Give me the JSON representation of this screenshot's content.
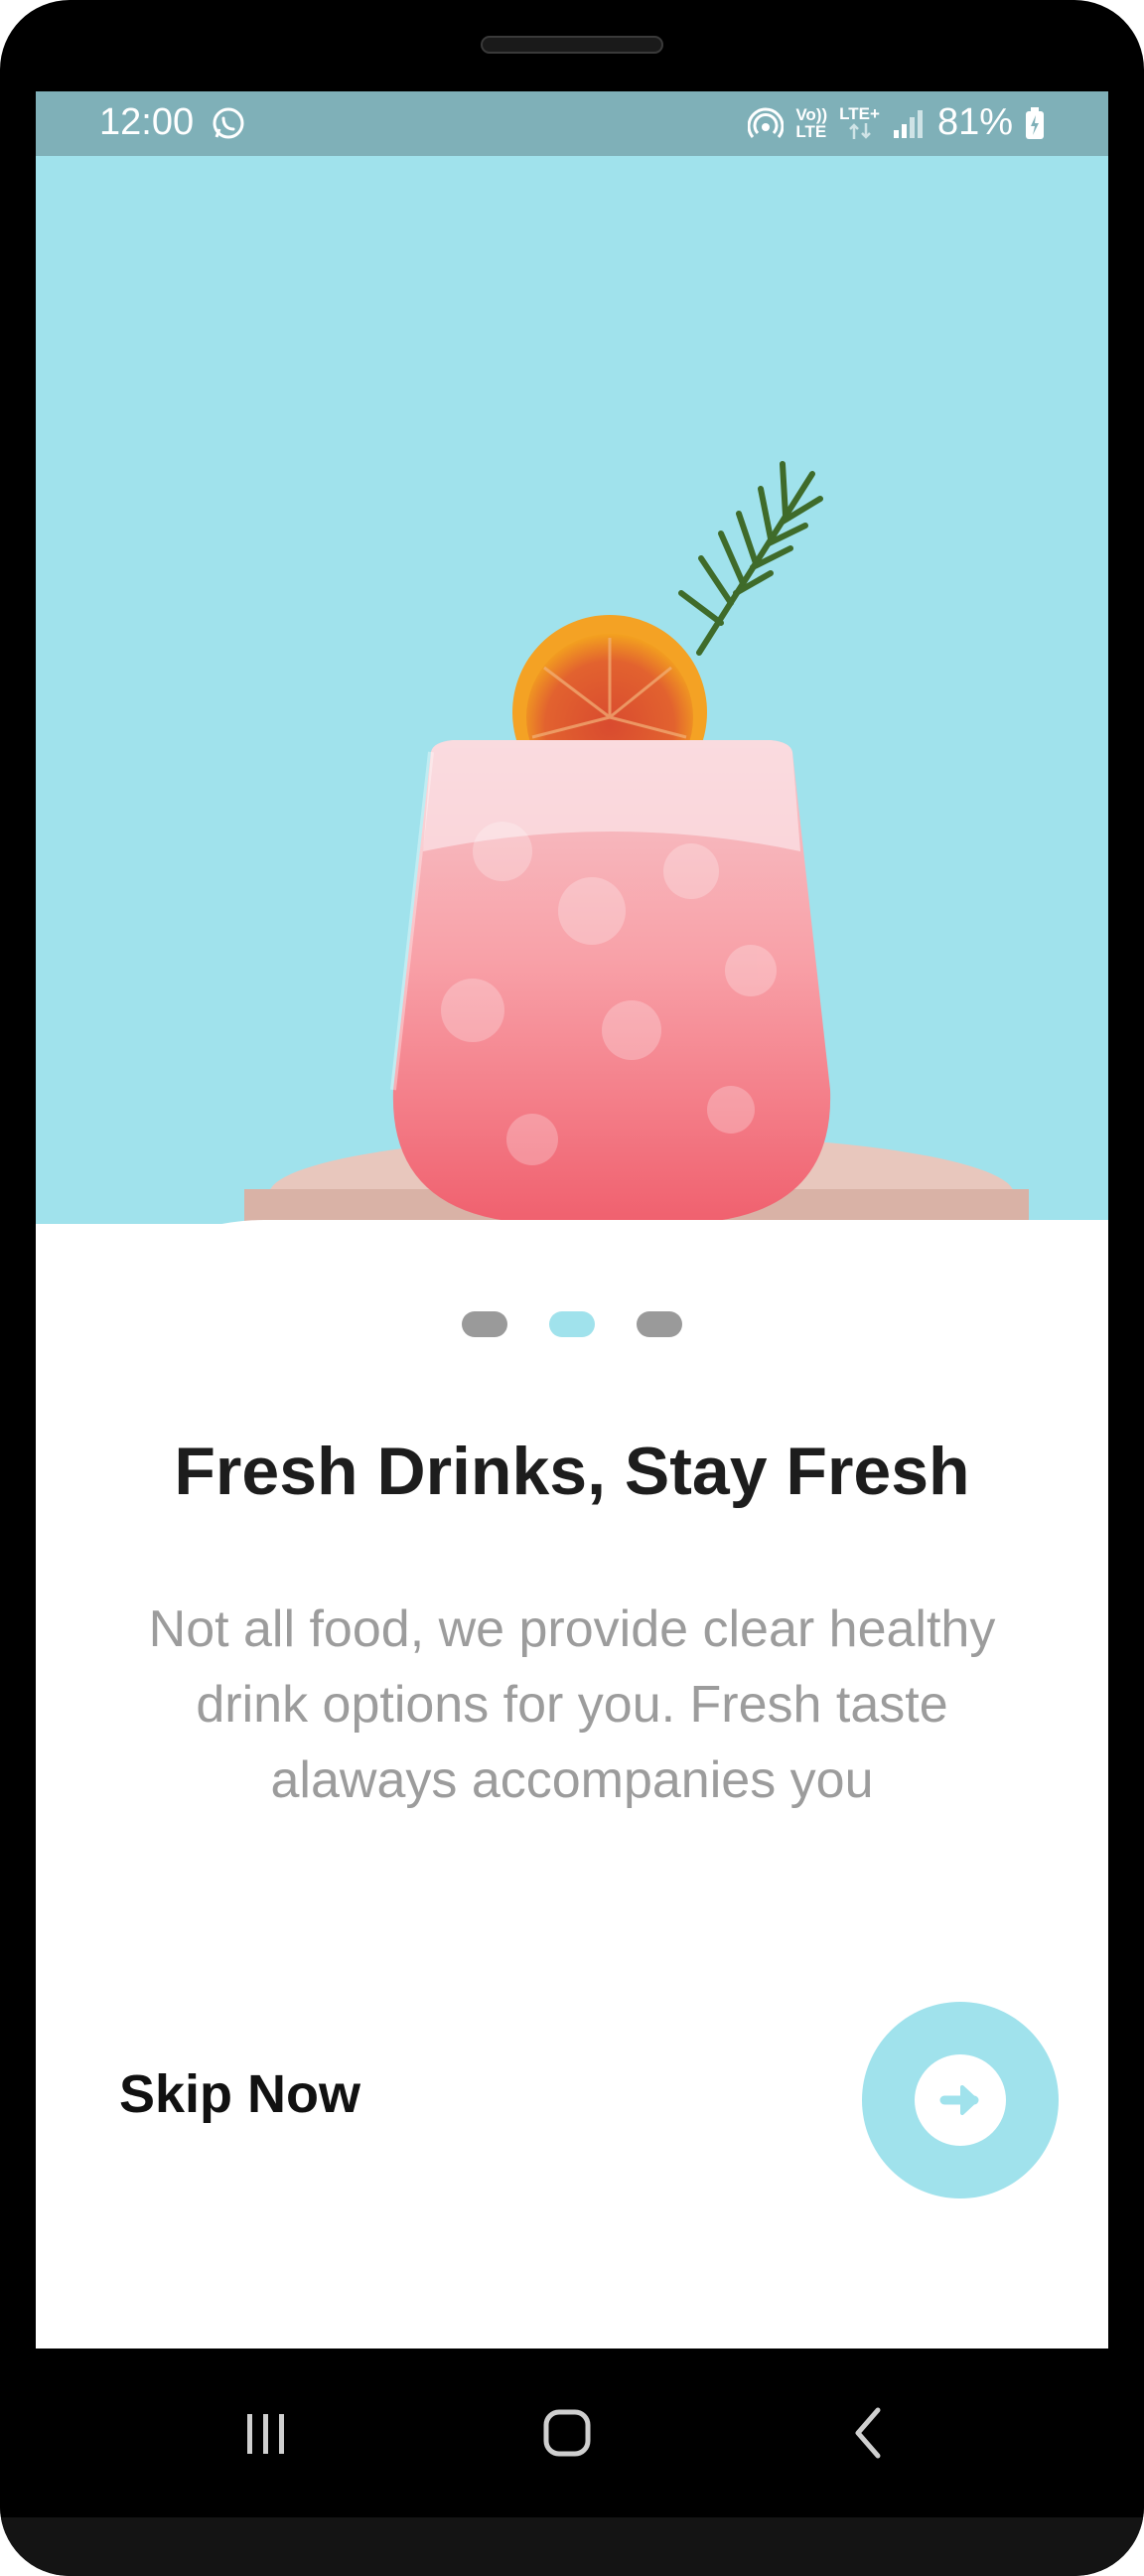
{
  "status_bar": {
    "time": "12:00",
    "network_label_top": "Vo))",
    "network_label_bottom": "LTE",
    "lte_plus": "LTE+",
    "battery": "81%"
  },
  "onboarding": {
    "page_indicator": {
      "total": 3,
      "active_index": 1
    },
    "title": "Fresh Drinks, Stay Fresh",
    "description": "Not all food, we provide clear healthy drink options for you. Fresh taste alaways accompanies you",
    "skip_label": "Skip Now",
    "next_icon": "arrow-right-icon"
  },
  "colors": {
    "accent": "#a0e2ec",
    "status_bar": "#7fb0b8",
    "title": "#1d1d1d",
    "description": "#9c9c9c",
    "inactive_dot": "#9a9a9a"
  },
  "system_nav": {
    "recents_icon": "recents-icon",
    "home_icon": "home-icon",
    "back_icon": "back-icon"
  }
}
